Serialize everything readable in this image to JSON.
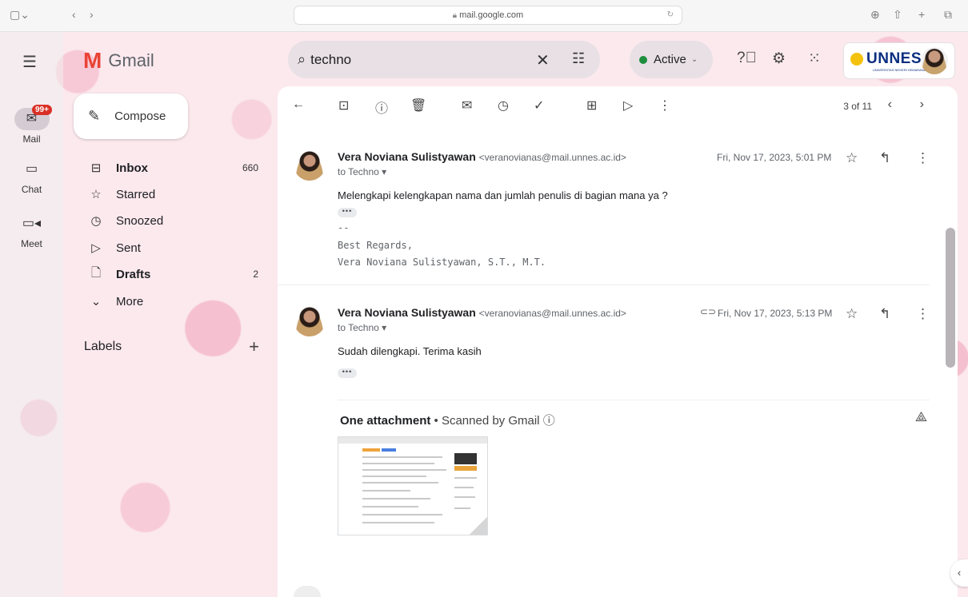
{
  "browser": {
    "url": "mail.google.com"
  },
  "rail": {
    "mail_label": "Mail",
    "mail_badge": "99+",
    "chat_label": "Chat",
    "meet_label": "Meet"
  },
  "brand": {
    "name": "Gmail"
  },
  "compose": {
    "label": "Compose"
  },
  "nav": [
    {
      "label": "Inbox",
      "count": "660",
      "icon": "inbox-icon",
      "bold": true
    },
    {
      "label": "Starred",
      "count": "",
      "icon": "star-icon",
      "bold": false
    },
    {
      "label": "Snoozed",
      "count": "",
      "icon": "clock-icon",
      "bold": false
    },
    {
      "label": "Sent",
      "count": "",
      "icon": "send-icon",
      "bold": false
    },
    {
      "label": "Drafts",
      "count": "2",
      "icon": "draft-icon",
      "bold": true
    },
    {
      "label": "More",
      "count": "",
      "icon": "chevron-down-icon",
      "bold": false
    }
  ],
  "labels": {
    "title": "Labels"
  },
  "search": {
    "value": "techno"
  },
  "status": {
    "label": "Active",
    "color": "#1e8e3e"
  },
  "org": {
    "name": "UNNES",
    "sub": "UNIVERSITAS NEGERI SEMARANG"
  },
  "pager": {
    "text": "3 of 11"
  },
  "messages": [
    {
      "sender": "Vera Noviana Sulistyawan",
      "email": "<veranovianas@mail.unnes.ac.id>",
      "to": "to Techno",
      "date": "Fri, Nov 17, 2023, 5:01 PM",
      "body": "Melengkapi kelengkapan nama dan jumlah penulis di bagian mana ya ?",
      "sig_dash": "--",
      "sig_1": "Best Regards,",
      "sig_2": "Vera Noviana Sulistyawan, S.T., M.T."
    },
    {
      "sender": "Vera Noviana Sulistyawan",
      "email": "<veranovianas@mail.unnes.ac.id>",
      "to": "to Techno",
      "date": "Fri, Nov 17, 2023, 5:13 PM",
      "body": "Sudah dilengkapi. Terima kasih"
    }
  ],
  "attachment": {
    "title": "One attachment",
    "scan": "Scanned by Gmail"
  },
  "colors": {
    "accent": "#ea4335",
    "badge": "#d93025"
  }
}
